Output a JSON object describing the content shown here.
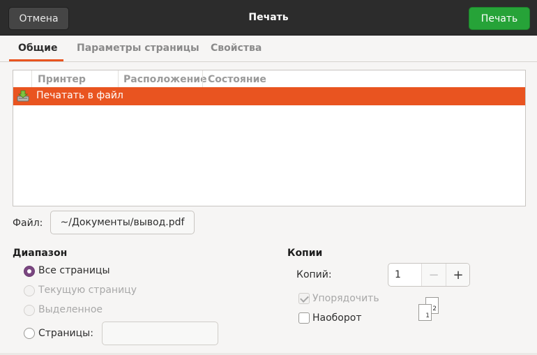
{
  "header": {
    "title": "Печать",
    "cancel_label": "Отмена",
    "print_label": "Печать"
  },
  "tabs": [
    {
      "label": "Общие",
      "active": true
    },
    {
      "label": "Параметры страницы",
      "active": false
    },
    {
      "label": "Свойства",
      "active": false
    }
  ],
  "printer_list": {
    "columns": [
      "Принтер",
      "Расположение",
      "Состояние"
    ],
    "rows": [
      {
        "icon": "print-to-file-icon",
        "name": "Печатать в файл",
        "selected": true
      }
    ]
  },
  "file": {
    "label": "Файл:",
    "value": "~/Документы/вывод.pdf"
  },
  "range": {
    "title": "Диапазон",
    "options": [
      {
        "label": "Все страницы",
        "checked": true,
        "enabled": true
      },
      {
        "label": "Текущую страницу",
        "checked": false,
        "enabled": false
      },
      {
        "label": "Выделенное",
        "checked": false,
        "enabled": false
      },
      {
        "label": "Страницы:",
        "checked": false,
        "enabled": true
      }
    ],
    "pages_value": ""
  },
  "copies": {
    "title": "Копии",
    "count_label": "Копий:",
    "count_value": "1",
    "minus_symbol": "−",
    "plus_symbol": "+",
    "collate_label": "Упорядочить",
    "collate_checked": true,
    "collate_enabled": false,
    "reverse_label": "Наоборот",
    "reverse_checked": false,
    "collate_preview_pages": [
      "1",
      "2"
    ]
  },
  "colors": {
    "accent": "#e95420",
    "print_button": "#26a338",
    "header_bg": "#2c2c2c",
    "radio_checked": "#7a4780"
  }
}
